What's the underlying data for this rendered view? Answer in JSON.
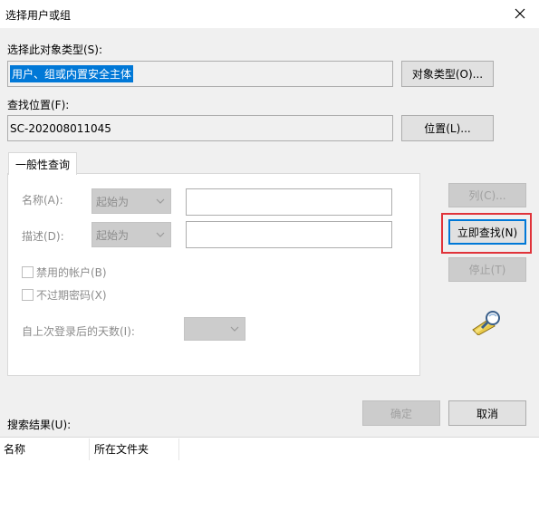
{
  "dialog": {
    "title": "选择用户或组"
  },
  "object_type": {
    "label": "选择此对象类型(S):",
    "value": "用户、组或内置安全主体",
    "button": "对象类型(O)..."
  },
  "location": {
    "label": "查找位置(F):",
    "value": "SC-202008011045",
    "button": "位置(L)..."
  },
  "tab": {
    "label": "一般性查询"
  },
  "query": {
    "name_label": "名称(A):",
    "name_mode": "起始为",
    "desc_label": "描述(D):",
    "desc_mode": "起始为",
    "disabled_accounts_label": "禁用的帐户(B)",
    "no_expire_label": "不过期密码(X)",
    "days_label": "自上次登录后的天数(I):"
  },
  "side_buttons": {
    "columns": "列(C)...",
    "find_now": "立即查找(N)",
    "stop": "停止(T)"
  },
  "footer": {
    "ok": "确定",
    "cancel": "取消"
  },
  "results": {
    "label": "搜索结果(U):",
    "columns": [
      "名称",
      "所在文件夹"
    ]
  },
  "icons": {
    "close": "close-icon",
    "search": "search-animation-icon"
  },
  "colors": {
    "accent": "#0078d7",
    "highlight": "#e0333a"
  }
}
